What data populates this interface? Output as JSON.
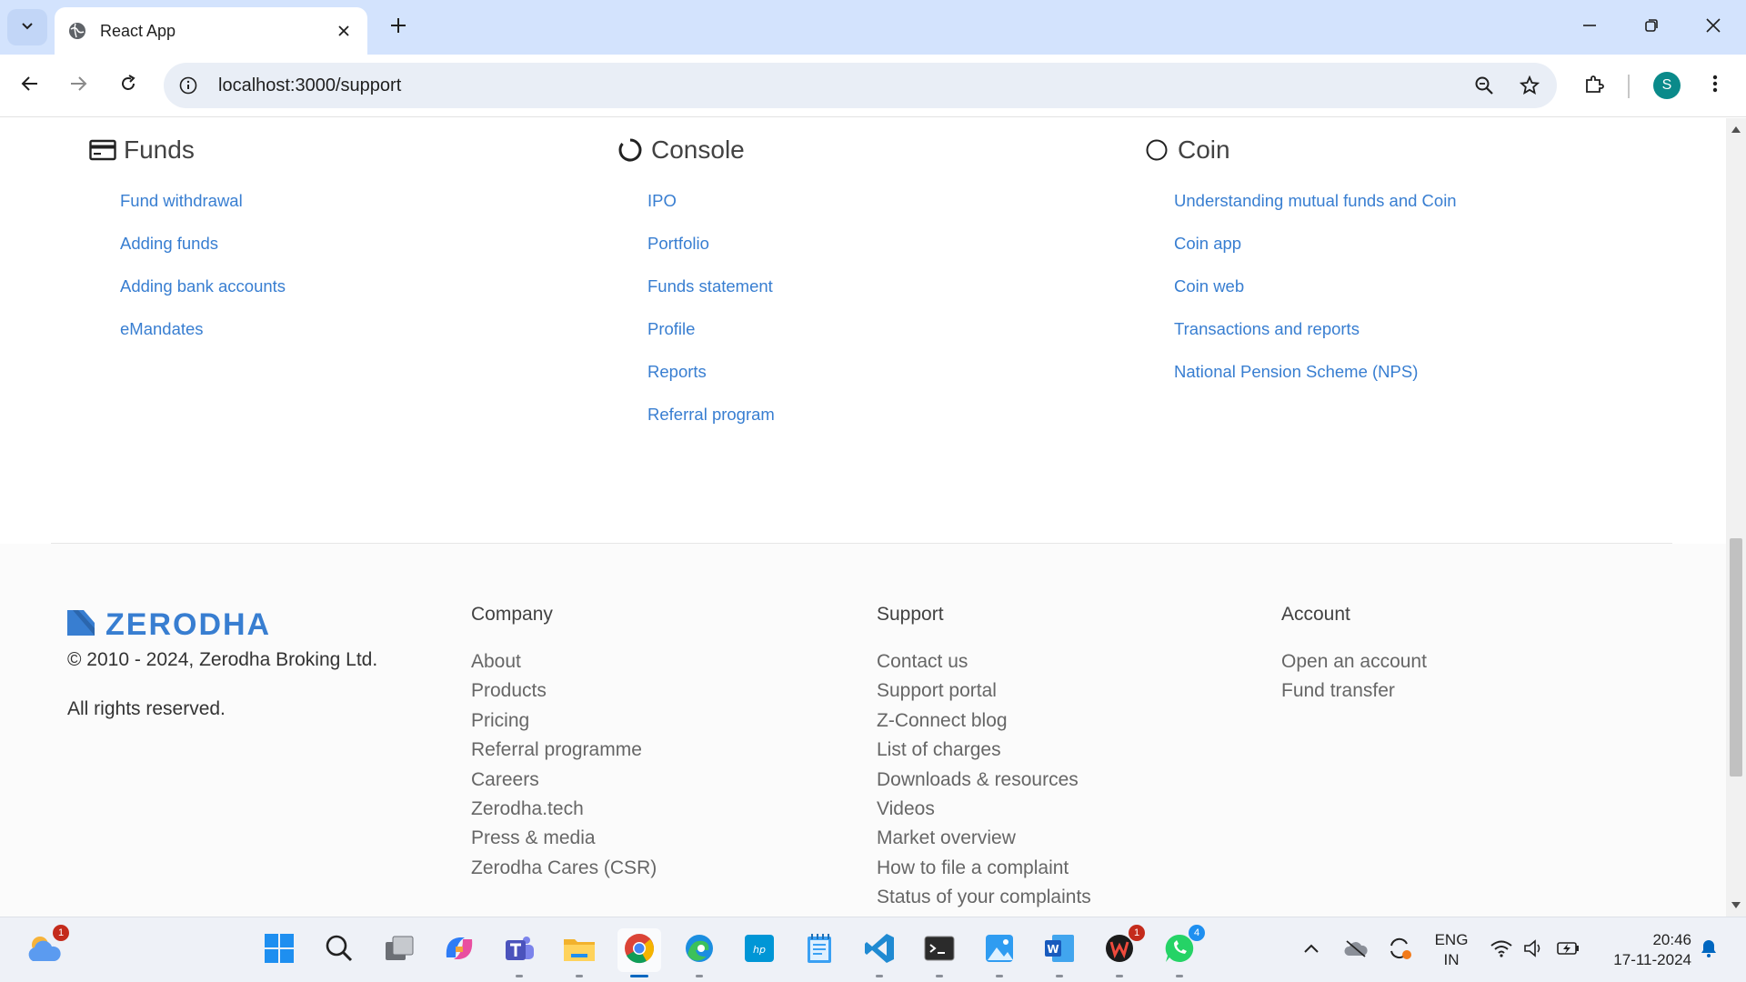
{
  "browser": {
    "tab_title": "React App",
    "url": "localhost:3000/support",
    "avatar_letter": "S"
  },
  "sections": [
    {
      "title": "Funds",
      "icon": "credit-card-icon",
      "links": [
        "Fund withdrawal",
        "Adding funds",
        "Adding bank accounts",
        "eMandates"
      ]
    },
    {
      "title": "Console",
      "icon": "spinner-circle-icon",
      "links": [
        "IPO",
        "Portfolio",
        "Funds statement",
        "Profile",
        "Reports",
        "Referral program"
      ]
    },
    {
      "title": "Coin",
      "icon": "circle-icon",
      "links": [
        "Understanding mutual funds and Coin",
        "Coin app",
        "Coin web",
        "Transactions and reports",
        "National Pension Scheme (NPS)"
      ]
    }
  ],
  "footer": {
    "brand": "ZERODHA",
    "copyright": "© 2010 - 2024, Zerodha Broking Ltd.",
    "rights": "All rights reserved.",
    "columns": [
      {
        "heading": "Company",
        "links": [
          "About",
          "Products",
          "Pricing",
          "Referral programme",
          "Careers",
          "Zerodha.tech",
          "Press & media",
          "Zerodha Cares (CSR)"
        ]
      },
      {
        "heading": "Support",
        "links": [
          "Contact us",
          "Support portal",
          "Z-Connect blog",
          "List of charges",
          "Downloads & resources",
          "Videos",
          "Market overview",
          "How to file a complaint",
          "Status of your complaints"
        ]
      },
      {
        "heading": "Account",
        "links": [
          "Open an account",
          "Fund transfer"
        ]
      }
    ]
  },
  "taskbar": {
    "weather_badge": "1",
    "word_badge": "1",
    "whatsapp_badge": "4",
    "lang_line1": "ENG",
    "lang_line2": "IN",
    "time": "20:46",
    "date": "17-11-2024",
    "colors": {
      "accent": "#0067c0",
      "badge_red": "#c42b1c",
      "badge_green": "#25d366"
    }
  },
  "colors": {
    "link": "#387ed1",
    "brand": "#387ed1",
    "tabbar": "#d3e3fd"
  }
}
